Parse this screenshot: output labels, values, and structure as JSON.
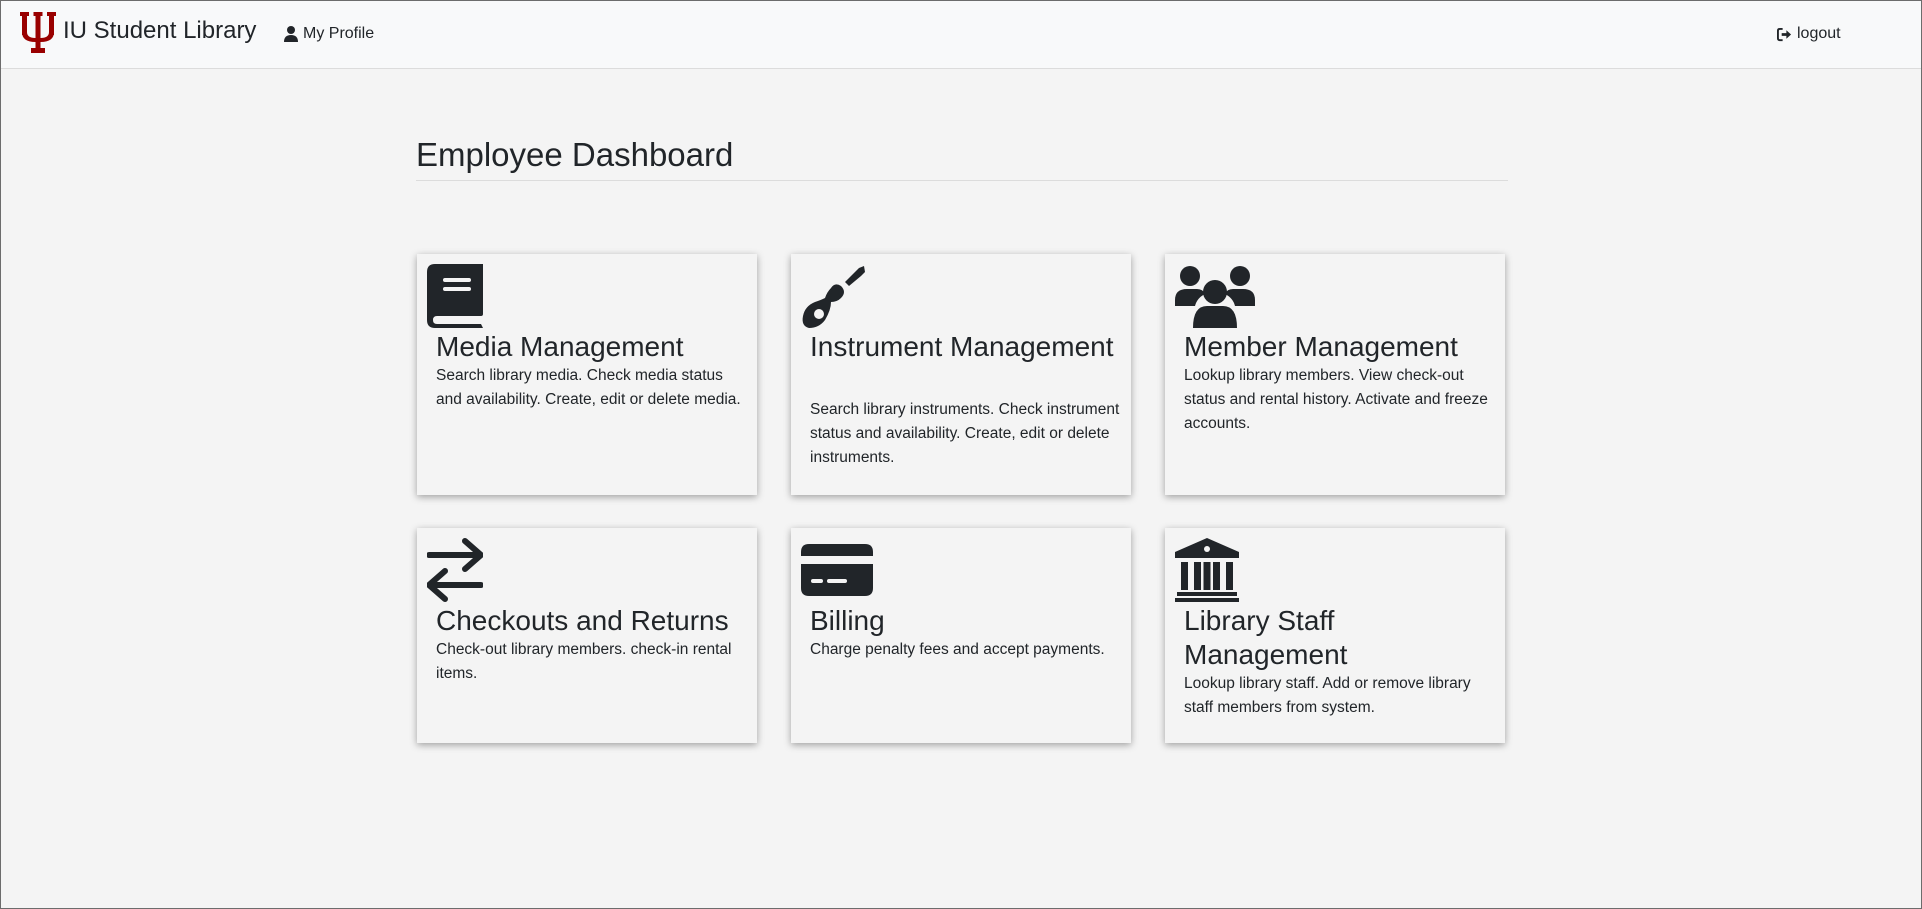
{
  "app": {
    "brand": "IU Student Library",
    "brand_color": "#990000"
  },
  "nav": {
    "profile_label": "My Profile",
    "profile_icon": "user-icon",
    "logout_label": "logout",
    "logout_icon": "sign-out-icon"
  },
  "page": {
    "title": "Employee Dashboard"
  },
  "cards": [
    {
      "icon": "book-icon",
      "title": "Media Management",
      "description": "Search library media. Check media status and availability. Create, edit or delete media."
    },
    {
      "icon": "guitar-icon",
      "title": "Instrument Management",
      "description": "Search library instruments. Check instrument status and availability. Create, edit or delete instruments."
    },
    {
      "icon": "users-icon",
      "title": "Member Management",
      "description": "Lookup library members. View check-out status and rental history. Activate and freeze accounts."
    },
    {
      "icon": "exchange-arrows-icon",
      "title": "Checkouts and Returns",
      "description": "Check-out library members. check-in rental items."
    },
    {
      "icon": "credit-card-icon",
      "title": "Billing",
      "description": "Charge penalty fees and accept payments."
    },
    {
      "icon": "landmark-icon",
      "title": "Library Staff Management",
      "description": "Lookup library staff. Add or remove library staff members from system."
    }
  ]
}
